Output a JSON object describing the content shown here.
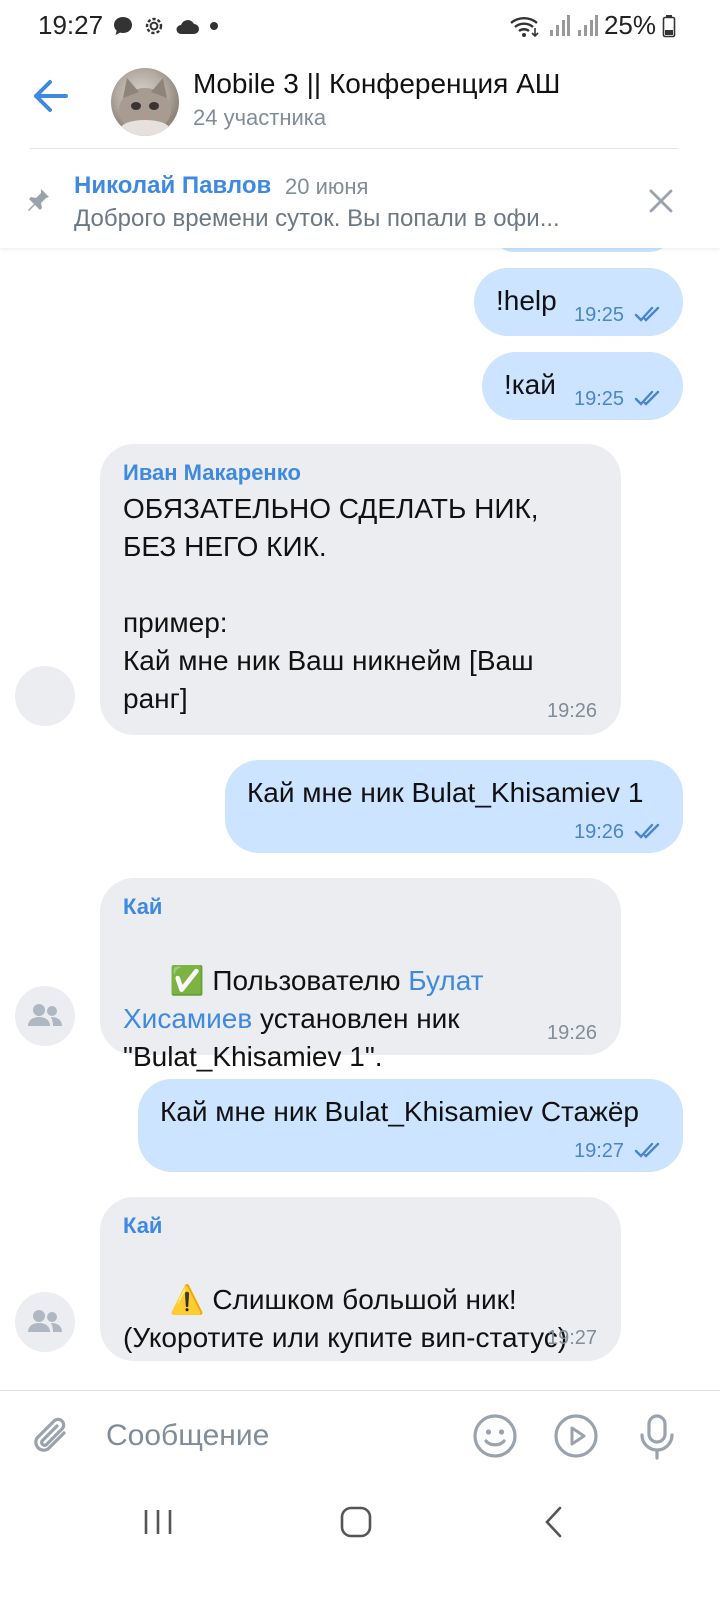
{
  "status_bar": {
    "time": "19:27",
    "battery": "25%",
    "icons_left": [
      "chat-bubble-icon",
      "gear-icon",
      "cloud-icon",
      "dot-icon"
    ],
    "icons_right": [
      "wifi-icon",
      "signal-icon",
      "signal-icon",
      "battery-icon"
    ]
  },
  "header": {
    "title": "Mobile 3 || Конференция АШ",
    "subtitle": "24 участника"
  },
  "pinned": {
    "author": "Николай Павлов",
    "date": "20 июня",
    "text": "Доброго времени суток.  Вы попали в офи..."
  },
  "messages": [
    {
      "direction": "out",
      "text": "!help",
      "time": "19:25"
    },
    {
      "direction": "out",
      "text": "!кай",
      "time": "19:25"
    },
    {
      "direction": "in",
      "sender": "Иван Макаренко",
      "text": "ОБЯЗАТЕЛЬНО СДЕЛАТЬ НИК,\nБЕЗ НЕГО КИК.\n\nпример:\nКай мне ник Ваш никнейм [Ваш\nранг]",
      "time": "19:26"
    },
    {
      "direction": "out",
      "text": "Кай мне ник Bulat_Khisamiev 1",
      "time": "19:26"
    },
    {
      "direction": "in",
      "sender": "Кай",
      "text_prefix": "✅ Пользователю ",
      "link": "Булат Хисамиев",
      "text_suffix": " установлен ник \"Bulat_Khisamiev 1\".",
      "line1": "✅ Пользователю ",
      "line1_link": "Булат",
      "line2_link": "Хисамиев",
      "line2": " установлен ник",
      "line3": "\"Bulat_Khisamiev 1\".",
      "time": "19:26"
    },
    {
      "direction": "out",
      "text": "Кай мне ник Bulat_Khisamiev Стажёр",
      "time": "19:27"
    },
    {
      "direction": "in",
      "sender": "Кай",
      "line1": "⚠️ Слишком большой ник!",
      "line2": "(Укоротите или купите вип-статус)",
      "time": "19:27"
    }
  ],
  "composer": {
    "placeholder": "Сообщение"
  },
  "colors": {
    "accent": "#3f8ae0",
    "outgoing_bubble": "#cce4ff",
    "incoming_bubble": "#ebedf0",
    "secondary_text": "#818c99"
  }
}
